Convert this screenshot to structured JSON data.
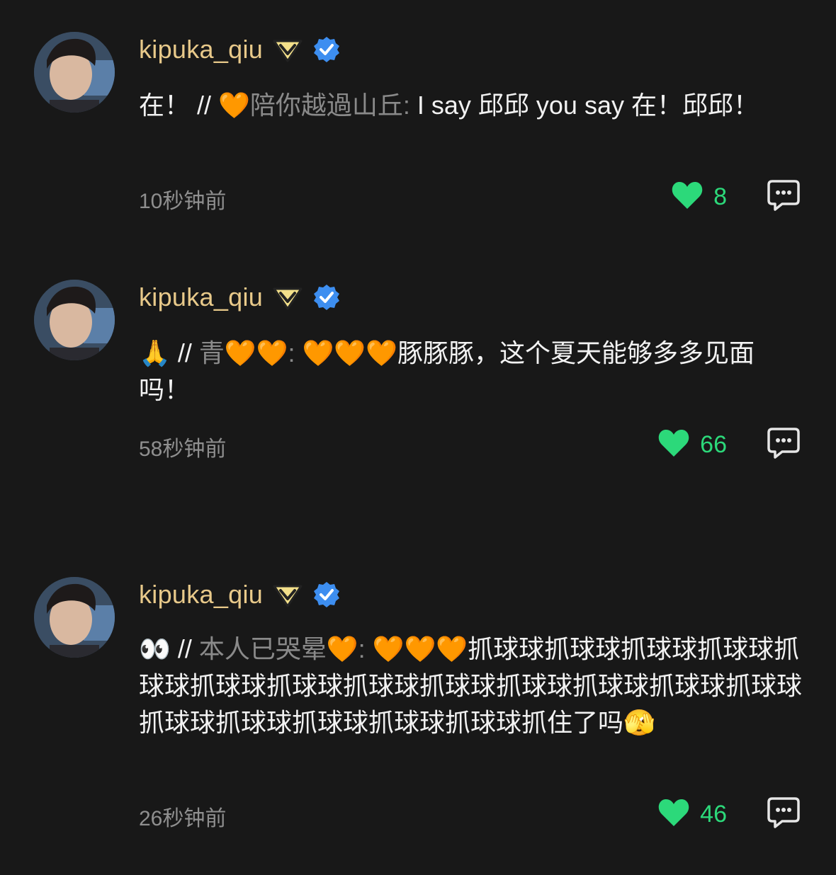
{
  "colors": {
    "background": "#181818",
    "username": "#e8c98a",
    "verified": "#3d8ef0",
    "like": "#2cd97a",
    "muted": "#8a8a8a"
  },
  "comments": [
    {
      "username": "kipuka_qiu",
      "text": "在！",
      "separator": " // ",
      "reply_emoji": "🧡",
      "quoted_user": "陪你越過山丘:",
      "quoted_text": " I say 邱邱 you say 在！邱邱！",
      "time": "10秒钟前",
      "likes": "8"
    },
    {
      "username": "kipuka_qiu",
      "text": "🙏",
      "separator": " // ",
      "quoted_user": "青🧡🧡:",
      "quoted_text": " 🧡🧡🧡豚豚豚，这个夏天能够多多见面吗！",
      "time": "58秒钟前",
      "likes": "66"
    },
    {
      "username": "kipuka_qiu",
      "text": "👀",
      "separator": " // ",
      "quoted_user": "本人已哭晕🧡:",
      "quoted_text": " 🧡🧡🧡抓球球抓球球抓球球抓球球抓球球抓球球抓球球抓球球抓球球抓球球抓球球抓球球抓球球抓球球抓球球抓球球抓球球抓球球抓住了吗🫣",
      "time": "26秒钟前",
      "likes": "46"
    }
  ],
  "icons": {
    "avatar": "avatar-photo",
    "level_badge": "diamond-badge-icon",
    "verified": "verified-check-icon",
    "like": "heart-icon",
    "reply": "comment-bubble-icon"
  }
}
